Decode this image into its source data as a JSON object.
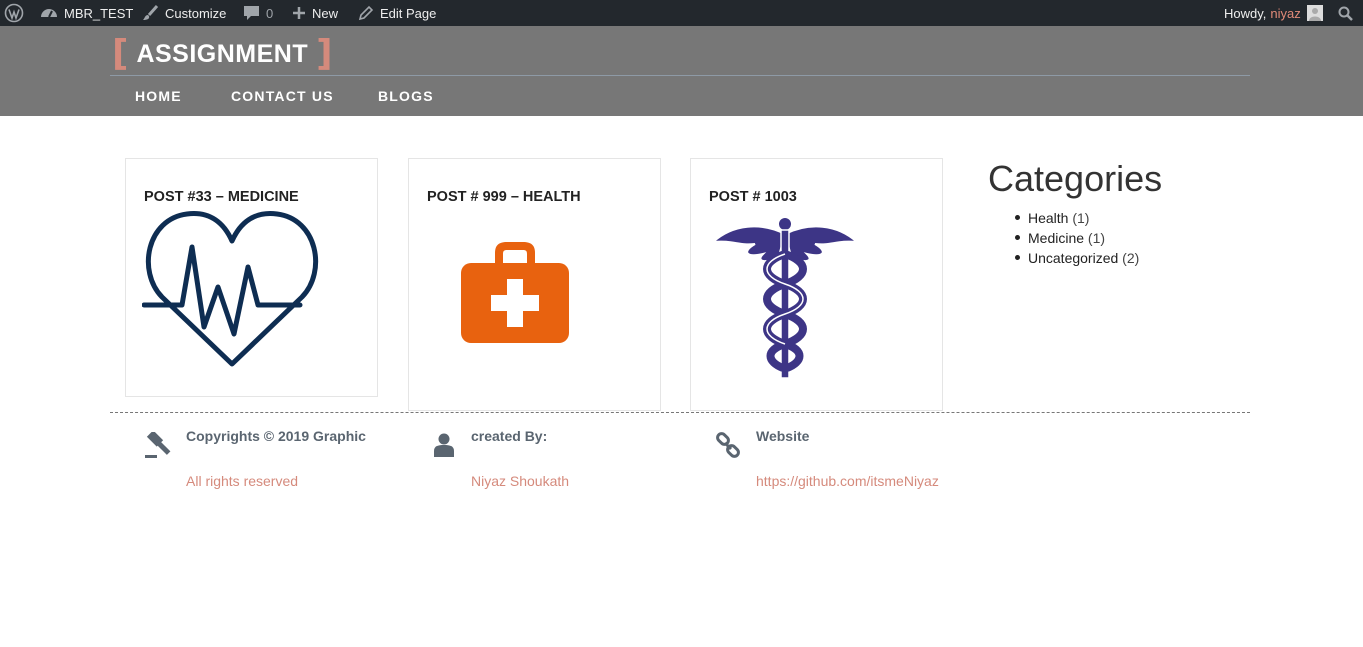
{
  "adminbar": {
    "site_name": "MBR_TEST",
    "customize_label": "Customize",
    "comments_count": "0",
    "new_label": "New",
    "edit_label": "Edit Page",
    "howdy_label": "Howdy,",
    "user_name": "niyaz",
    "icons": [
      "wordpress-icon",
      "dashboard-icon",
      "brush-icon",
      "comment-icon",
      "plus-icon",
      "pencil-icon",
      "avatar",
      "search-icon"
    ]
  },
  "header": {
    "logo_open": "[",
    "logo_text": "ASSIGNMENT",
    "logo_close": "]",
    "nav": [
      "HOME",
      "CONTACT US",
      "BLOGS"
    ]
  },
  "posts": [
    {
      "title": "POST #33 – MEDICINE",
      "image": "heart-pulse-icon"
    },
    {
      "title": "POST # 999 – HEALTH",
      "image": "first-aid-kit-icon"
    },
    {
      "title": "POST # 1003",
      "image": "caduceus-icon"
    }
  ],
  "sidebar": {
    "title": "Categories",
    "categories": [
      {
        "name": "Health",
        "count": "(1)"
      },
      {
        "name": "Medicine",
        "count": "(1)"
      },
      {
        "name": "Uncategorized",
        "count": "(2)"
      }
    ]
  },
  "footer": {
    "columns": [
      {
        "icon": "gavel-icon",
        "heading": "Copyrights © 2019 Graphic",
        "text": "All rights reserved"
      },
      {
        "icon": "user-icon",
        "heading": "created By:",
        "text": "Niyaz Shoukath"
      },
      {
        "icon": "link-icon",
        "heading": "Website",
        "text": "https://github.com/itsmeNiyaz"
      }
    ]
  },
  "colors": {
    "adminbar_bg": "#23282d",
    "header_bg": "#777777",
    "accent": "#d58a7c",
    "heart": "#0e2d52",
    "kit": "#e8620f",
    "caduceus": "#3d3586"
  }
}
